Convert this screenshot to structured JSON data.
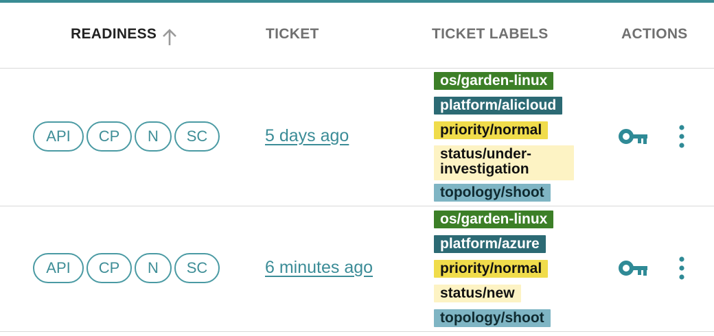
{
  "header": {
    "readiness": "READINESS",
    "ticket": "TICKET",
    "ticket_labels": "TICKET LABELS",
    "actions": "ACTIONS"
  },
  "colors": {
    "accent": "#3a8c94"
  },
  "rows": [
    {
      "chips": [
        "API",
        "CP",
        "N",
        "SC"
      ],
      "ticket": "5 days ago",
      "labels": [
        "os/garden-linux",
        "platform/alicloud",
        "priority/normal",
        "status/under-investigation",
        "topology/shoot"
      ]
    },
    {
      "chips": [
        "API",
        "CP",
        "N",
        "SC"
      ],
      "ticket": "6 minutes ago",
      "labels": [
        "os/garden-linux",
        "platform/azure",
        "priority/normal",
        "status/new",
        "topology/shoot"
      ]
    }
  ],
  "icons": {
    "sort": "arrow-up-icon",
    "key": "key-icon",
    "more": "more-vert-icon"
  }
}
